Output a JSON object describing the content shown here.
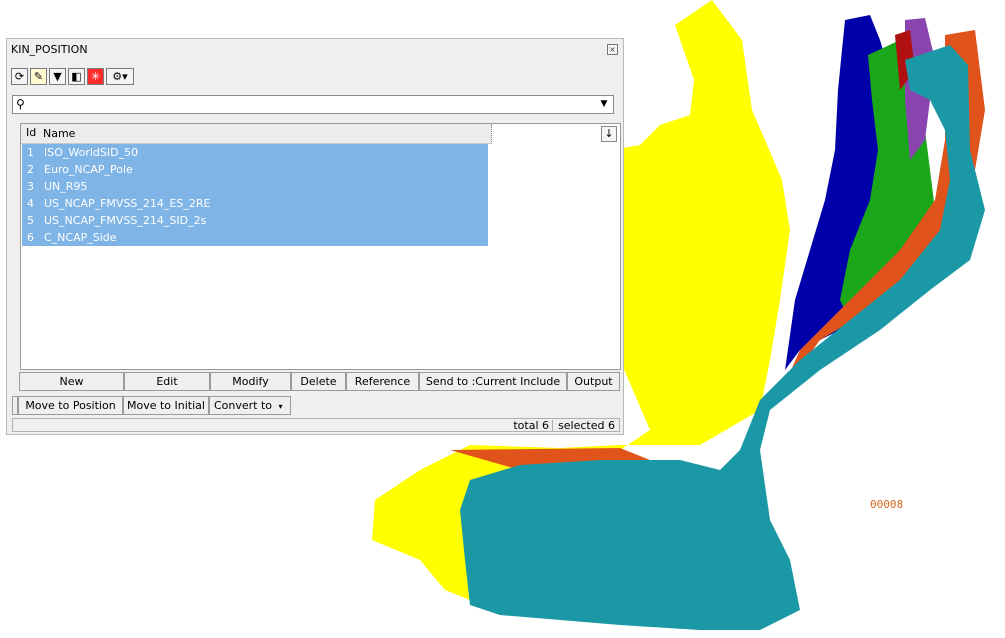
{
  "window": {
    "title": "KIN_POSITION"
  },
  "toolbar": {
    "icons": [
      "refresh-icon",
      "highlight-icon",
      "filter-icon",
      "frame-icon",
      "select-icon",
      "settings-icon"
    ]
  },
  "search": {
    "placeholder": "",
    "value": ""
  },
  "table": {
    "columns": {
      "id": "Id",
      "name": "Name"
    },
    "rows": [
      {
        "id": "1",
        "name": "ISO_WorldSID_50"
      },
      {
        "id": "2",
        "name": "Euro_NCAP_Pole"
      },
      {
        "id": "3",
        "name": "UN_R95"
      },
      {
        "id": "4",
        "name": "US_NCAP_FMVSS_214_ES_2RE"
      },
      {
        "id": "5",
        "name": "US_NCAP_FMVSS_214_SID_2s"
      },
      {
        "id": "6",
        "name": "C_NCAP_Side"
      }
    ]
  },
  "buttons": {
    "new": "New",
    "edit": "Edit",
    "modify": "Modify",
    "delete": "Delete",
    "reference": "Reference",
    "send_to": "Send to :Current Include",
    "output": "Output",
    "move_to_position": "Move to Position",
    "move_to_initial": "Move to Initial",
    "convert_to": "Convert to"
  },
  "status": {
    "total": "total 6",
    "selected": "selected 6"
  },
  "viewport": {
    "label": "00008"
  },
  "colors": {
    "selection": "#7fb4e6",
    "seat_yellow": "#ffff00",
    "seat_teal": "#1b98a5",
    "seat_blue": "#0000aa",
    "seat_green": "#1aa81a",
    "seat_orange": "#e0531a"
  }
}
